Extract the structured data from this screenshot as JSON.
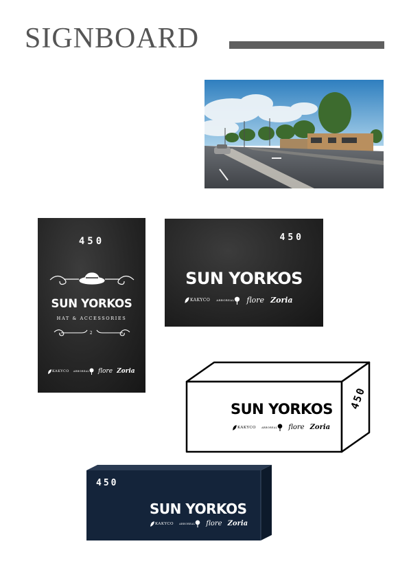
{
  "page": {
    "title": "SIGNBOARD"
  },
  "colors": {
    "title": "#555555",
    "rule": "#5f5f5f",
    "navy": "#14243a",
    "chalk": "#262626",
    "box_line": "#000000"
  },
  "street_photo": {
    "icons": [
      "sky",
      "clouds",
      "trees",
      "building",
      "road",
      "car"
    ]
  },
  "sign_vertical": {
    "number": "450",
    "brand": "SUN YORKOS",
    "tagline": "HAT & ACCESSORIES",
    "ornament_number": "2",
    "logos": [
      "KAKYCO",
      "ARBOREAL",
      "flore",
      "Zoria"
    ]
  },
  "sign_horizontal": {
    "number": "450",
    "brand": "SUN YORKOS",
    "logos": [
      "KAKYCO",
      "ARBOREAL",
      "flore",
      "Zoria"
    ]
  },
  "sign_white_box": {
    "number": "450",
    "brand": "SUN YORKOS",
    "logos": [
      "KAKYCO",
      "ARBOREAL",
      "flore",
      "Zoria"
    ]
  },
  "sign_navy_box": {
    "number": "450",
    "brand": "SUN YORKOS",
    "logos": [
      "KAKYCO",
      "ARBOREAL",
      "flore",
      "Zoria"
    ]
  }
}
